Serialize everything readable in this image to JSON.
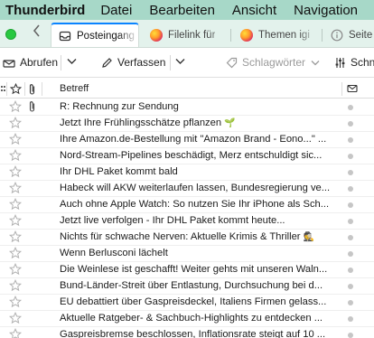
{
  "menubar": {
    "app_name": "Thunderbird",
    "items": [
      "Datei",
      "Bearbeiten",
      "Ansicht",
      "Navigation",
      "N"
    ]
  },
  "tabs": [
    {
      "label": "Posteingang",
      "icon": "inbox-icon",
      "active": true
    },
    {
      "label": "Filelink für",
      "icon": "firefox-icon",
      "active": false
    },
    {
      "label": "Themen igi",
      "icon": "firefox-icon",
      "active": false
    },
    {
      "label": "Seite",
      "icon": "info-icon",
      "active": false
    }
  ],
  "toolbar": {
    "get_messages": "Abrufen",
    "compose": "Verfassen",
    "tags": "Schlagwörter",
    "filter": "Schn"
  },
  "columns": {
    "subject": "Betreff"
  },
  "colors": {
    "menubar_bg": "#a7d8c8",
    "tabstrip_bg": "#e3f2ec",
    "active_tab_accent": "#0a84ff",
    "read_dot": "#c6c6c6"
  },
  "messages": [
    {
      "subject": "R: Rechnung zur Sendung",
      "attachment": true,
      "emoji": ""
    },
    {
      "subject": "Jetzt Ihre Frühlingsschätze pflanzen",
      "attachment": false,
      "emoji": "🌱"
    },
    {
      "subject": "Ihre Amazon.de-Bestellung mit \"Amazon Brand - Eono...\" ...",
      "attachment": false,
      "emoji": ""
    },
    {
      "subject": "Nord-Stream-Pipelines beschädigt, Merz entschuldigt sic...",
      "attachment": false,
      "emoji": ""
    },
    {
      "subject": "Ihr DHL Paket kommt bald",
      "attachment": false,
      "emoji": ""
    },
    {
      "subject": "Habeck will AKW weiterlaufen lassen, Bundesregierung ve...",
      "attachment": false,
      "emoji": ""
    },
    {
      "subject": "Auch ohne Apple Watch: So nutzen Sie Ihr iPhone als Sch...",
      "attachment": false,
      "emoji": ""
    },
    {
      "subject": "Jetzt live verfolgen - Ihr DHL Paket kommt heute...",
      "attachment": false,
      "emoji": ""
    },
    {
      "subject": "Nichts für schwache Nerven: Aktuelle Krimis & Thriller",
      "attachment": false,
      "emoji": "🕵"
    },
    {
      "subject": "Wenn Berlusconi lächelt",
      "attachment": false,
      "emoji": ""
    },
    {
      "subject": "Die Weinlese ist geschafft! Weiter gehts mit unseren Waln...",
      "attachment": false,
      "emoji": ""
    },
    {
      "subject": "Bund-Länder-Streit über Entlastung, Durchsuchung bei d...",
      "attachment": false,
      "emoji": ""
    },
    {
      "subject": "EU debattiert über Gaspreisdeckel, Italiens Firmen gelass...",
      "attachment": false,
      "emoji": ""
    },
    {
      "subject": "Aktuelle Ratgeber- & Sachbuch-Highlights zu entdecken ...",
      "attachment": false,
      "emoji": ""
    },
    {
      "subject": "Gaspreisbremse beschlossen, Inflationsrate steigt auf 10 ...",
      "attachment": false,
      "emoji": ""
    }
  ]
}
